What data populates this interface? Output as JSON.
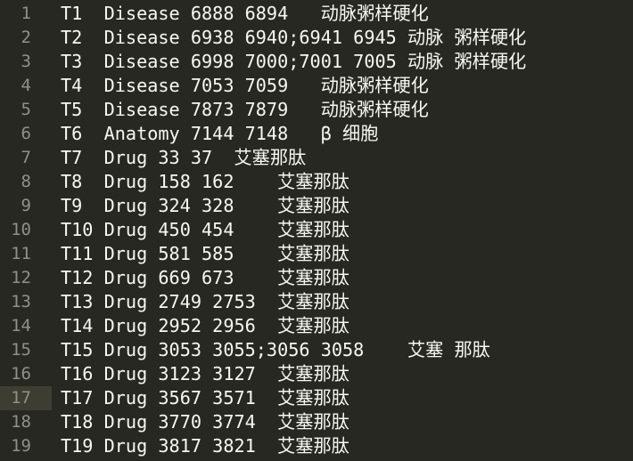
{
  "editor": {
    "current_line": 17,
    "lines": [
      {
        "number": "1",
        "text": "T1\tDisease 6888 6894\t动脉粥样硬化"
      },
      {
        "number": "2",
        "text": "T2\tDisease 6938 6940;6941 6945\t动脉 粥样硬化"
      },
      {
        "number": "3",
        "text": "T3\tDisease 6998 7000;7001 7005\t动脉 粥样硬化"
      },
      {
        "number": "4",
        "text": "T4\tDisease 7053 7059\t动脉粥样硬化"
      },
      {
        "number": "5",
        "text": "T5\tDisease 7873 7879\t动脉粥样硬化"
      },
      {
        "number": "6",
        "text": "T6\tAnatomy 7144 7148\tβ 细胞"
      },
      {
        "number": "7",
        "text": "T7\tDrug 33 37\t艾塞那肽"
      },
      {
        "number": "8",
        "text": "T8\tDrug 158 162\t艾塞那肽"
      },
      {
        "number": "9",
        "text": "T9\tDrug 324 328\t艾塞那肽"
      },
      {
        "number": "10",
        "text": "T10\tDrug 450 454\t艾塞那肽"
      },
      {
        "number": "11",
        "text": "T11\tDrug 581 585\t艾塞那肽"
      },
      {
        "number": "12",
        "text": "T12\tDrug 669 673\t艾塞那肽"
      },
      {
        "number": "13",
        "text": "T13\tDrug 2749 2753\t艾塞那肽"
      },
      {
        "number": "14",
        "text": "T14\tDrug 2952 2956\t艾塞那肽"
      },
      {
        "number": "15",
        "text": "T15\tDrug 3053 3055;3056 3058\t艾塞 那肽"
      },
      {
        "number": "16",
        "text": "T16\tDrug 3123 3127\t艾塞那肽"
      },
      {
        "number": "17",
        "text": "T17\tDrug 3567 3571\t艾塞那肽"
      },
      {
        "number": "18",
        "text": "T18\tDrug 3770 3774\t艾塞那肽"
      },
      {
        "number": "19",
        "text": "T19\tDrug 3817 3821\t艾塞那肽"
      }
    ]
  },
  "colors": {
    "background": "#272822",
    "text": "#f8f8f2",
    "gutter_text": "#8f908a",
    "current_line_gutter": "#3e3d32"
  }
}
